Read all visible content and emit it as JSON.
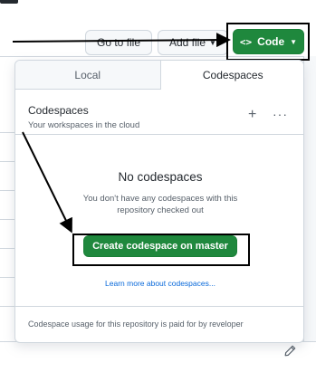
{
  "toolbar": {
    "goto_file_label": "Go to file",
    "add_file_label": "Add file",
    "code_icon": "<>",
    "code_label": "Code"
  },
  "panel": {
    "tabs": [
      {
        "label": "Local",
        "active": false
      },
      {
        "label": "Codespaces",
        "active": true
      }
    ],
    "header": {
      "title": "Codespaces",
      "subtitle": "Your workspaces in the cloud",
      "add_glyph": "+",
      "more_glyph": "···"
    },
    "empty": {
      "title": "No codespaces",
      "description": "You don't have any codespaces with this repository checked out"
    },
    "create_label": "Create codespace on master",
    "learn_link": "Learn more about codespaces...",
    "footer": "Codespace usage for this repository is paid for by reveloper"
  },
  "colors": {
    "primary_green": "#1f883d",
    "link_blue": "#0969da",
    "border": "#d0d7de",
    "annotation": "#000000"
  },
  "icons": {
    "code": "code-brackets-icon",
    "caret": "chevron-down-icon",
    "add": "plus-icon",
    "more": "kebab-horizontal-icon",
    "edit": "pencil-icon"
  }
}
